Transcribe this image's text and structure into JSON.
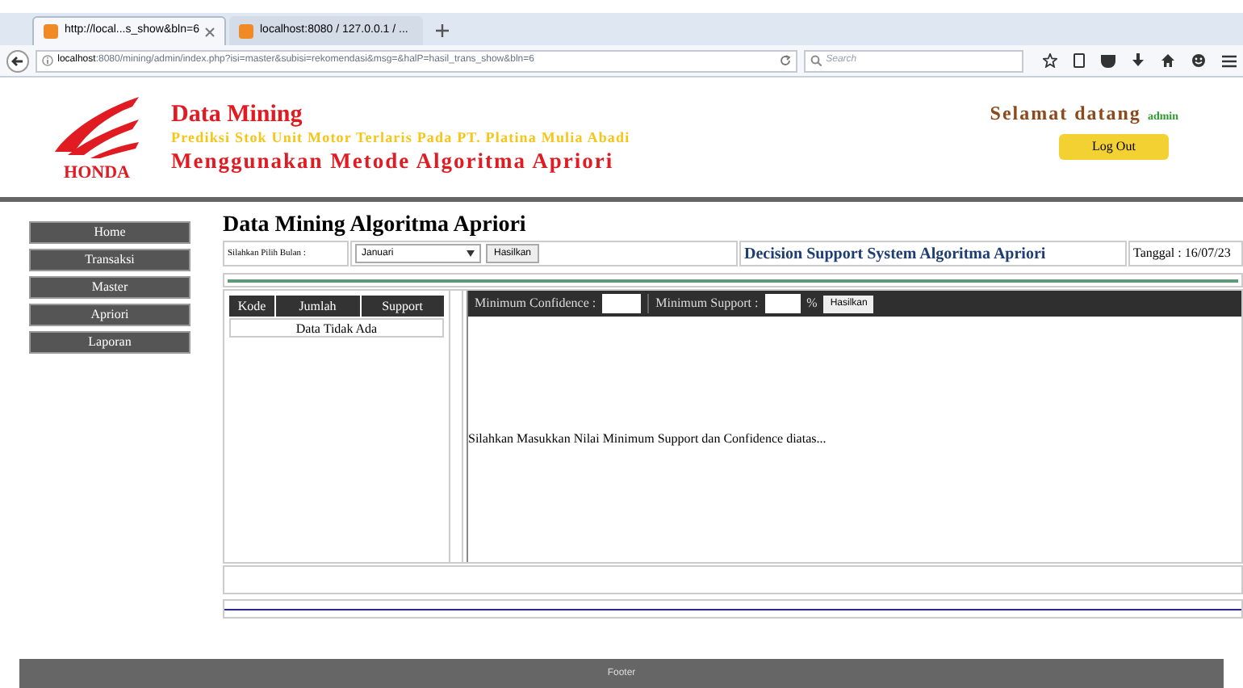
{
  "browser": {
    "tabs": [
      {
        "title": "http://local...s_show&bln=6",
        "selected": true
      },
      {
        "title": "localhost:8080 / 127.0.0.1 / ...",
        "selected": false
      }
    ],
    "address_host": "localhost",
    "address_rest": ":8080/mining/admin/index.php?isi=master&subisi=rekomendasi&msg=&halP=hasil_trans_show&bln=6",
    "search_placeholder": "Search"
  },
  "header": {
    "logo_text": "HONDA",
    "title": "Data Mining",
    "subtitle": "Prediksi Stok Unit Motor Terlaris Pada PT. Platina Mulia Abadi",
    "method": "Menggunakan Metode Algoritma Apriori",
    "welcome": "Selamat datang",
    "user": "admin",
    "logout": "Log Out"
  },
  "sidebar": {
    "items": [
      "Home",
      "Transaksi",
      "Master",
      "Apriori",
      "Laporan"
    ]
  },
  "content": {
    "heading": "Data Mining Algoritma Apriori",
    "month_label": "Silahkan Pilih Bulan :",
    "month_value": "Januari",
    "submit": "Hasilkan",
    "system_title": "Decision Support System Algoritma Apriori",
    "date": "Tanggal : 16/07/23"
  },
  "table": {
    "columns": [
      "Kode",
      "Jumlah",
      "Support"
    ],
    "empty_message": "Data Tidak Ada"
  },
  "params": {
    "confidence_label": "Minimum Confidence :",
    "support_label": "Minimum Support :",
    "percent": "%",
    "submit": "Hasilkan",
    "message": "Silahkan Masukkan Nilai Minimum Support dan Confidence diatas..."
  },
  "footer": {
    "text": "Footer"
  }
}
